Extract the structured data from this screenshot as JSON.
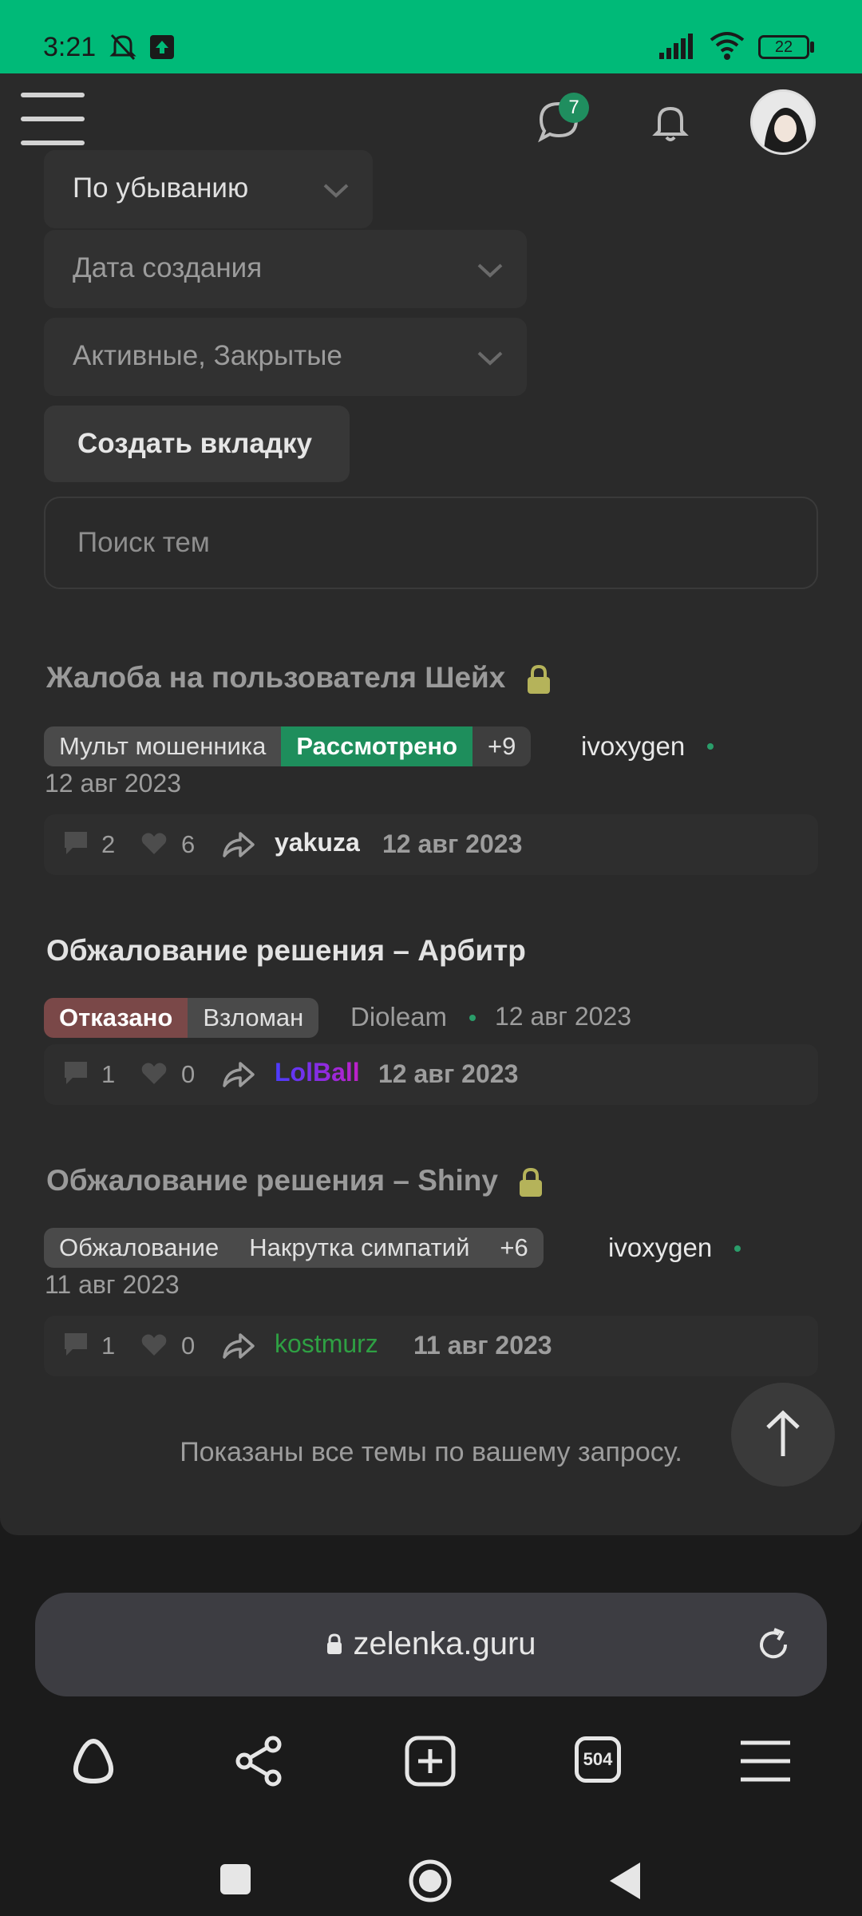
{
  "status_bar": {
    "time": "3:21",
    "battery": "22"
  },
  "header": {
    "messages_badge": "7"
  },
  "filters": {
    "sort_order": "По убыванию",
    "sort_field": "Дата создания",
    "state": "Активные, Закрытые",
    "create_tab_label": "Создать вкладку",
    "search_placeholder": "Поиск тем"
  },
  "threads": [
    {
      "title": "Жалоба на пользователя Шейх",
      "locked": true,
      "tags": [
        "Мульт мошенника",
        "Рассмотрено",
        "+9"
      ],
      "author": "ivoxygen",
      "date": "12 авг 2023",
      "replies": "2",
      "likes": "6",
      "last_user": "yakuza",
      "last_date": "12 авг 2023"
    },
    {
      "title": "Обжалование решения – Арбитр",
      "locked": false,
      "tags": [
        "Отказано",
        "Взломан"
      ],
      "author": "Dioleam",
      "date": "12 авг 2023",
      "replies": "1",
      "likes": "0",
      "last_user": "LolBall",
      "last_date": "12 авг 2023"
    },
    {
      "title": "Обжалование решения – Shiny",
      "locked": true,
      "tags": [
        "Обжалование",
        "Накрутка симпатий",
        "+6"
      ],
      "author": "ivoxygen",
      "date": "11 авг 2023",
      "replies": "1",
      "likes": "0",
      "last_user": "kostmurz",
      "last_date": "11 авг 2023"
    }
  ],
  "footer_note": "Показаны все темы по вашему запросу.",
  "browser": {
    "url": "zelenka.guru",
    "tab_count": "504"
  },
  "colors": {
    "accent": "#00ba78",
    "tag_green": "#1e8e5c",
    "tag_red": "#7a4848",
    "lock": "#b5b35a",
    "user_green": "#2ea043"
  }
}
